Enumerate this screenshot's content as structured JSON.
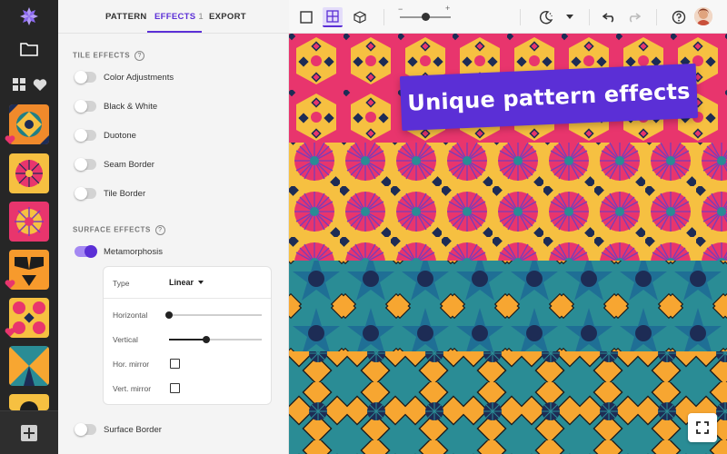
{
  "tabs": [
    {
      "label": "PATTERN",
      "active": false
    },
    {
      "label": "EFFECTS",
      "active": true,
      "count": "1"
    },
    {
      "label": "EXPORT",
      "active": false
    }
  ],
  "tile_effects": {
    "title": "TILE EFFECTS",
    "help": "?",
    "toggles": [
      {
        "label": "Color Adjustments",
        "on": false
      },
      {
        "label": "Black & White",
        "on": false
      },
      {
        "label": "Duotone",
        "on": false
      },
      {
        "label": "Seam Border",
        "on": false
      },
      {
        "label": "Tile Border",
        "on": false
      }
    ]
  },
  "surface_effects": {
    "title": "SURFACE EFFECTS",
    "help": "?",
    "metamorphosis": {
      "label": "Metamorphosis",
      "on": true
    },
    "type_label": "Type",
    "type_value": "Linear",
    "horizontal_label": "Horizontal",
    "horizontal_value": 0.0,
    "vertical_label": "Vertical",
    "vertical_value": 0.4,
    "hor_mirror_label": "Hor. mirror",
    "hor_mirror_checked": false,
    "vert_mirror_label": "Vert. mirror",
    "vert_mirror_checked": false,
    "surface_border": {
      "label": "Surface Border",
      "on": false
    }
  },
  "toolbar": {
    "zoom_minus": "−",
    "zoom_plus": "+",
    "zoom_value": 0.5
  },
  "banner": {
    "text": "Unique pattern effects"
  },
  "colors": {
    "accent": "#5b2fd6",
    "rail_bg": "#262626",
    "panel_bg": "#f4f4f4",
    "pattern_orange": "#f7a631",
    "pattern_pink": "#e8356d",
    "pattern_teal": "#2a8c95",
    "pattern_navy": "#1d2c55",
    "pattern_yellow": "#f5c33b"
  },
  "icons": {
    "logo": "star-logo-icon",
    "folder": "folder-icon",
    "grid": "grid-icon",
    "favorites": "heart-icon",
    "add": "plus-icon",
    "single_tile": "single-tile-icon",
    "tile_grid": "tile-grid-icon",
    "cube": "cube-icon",
    "theme": "moon-icon",
    "undo": "undo-icon",
    "redo": "redo-icon",
    "help": "help-icon",
    "fullscreen": "fullscreen-icon"
  }
}
